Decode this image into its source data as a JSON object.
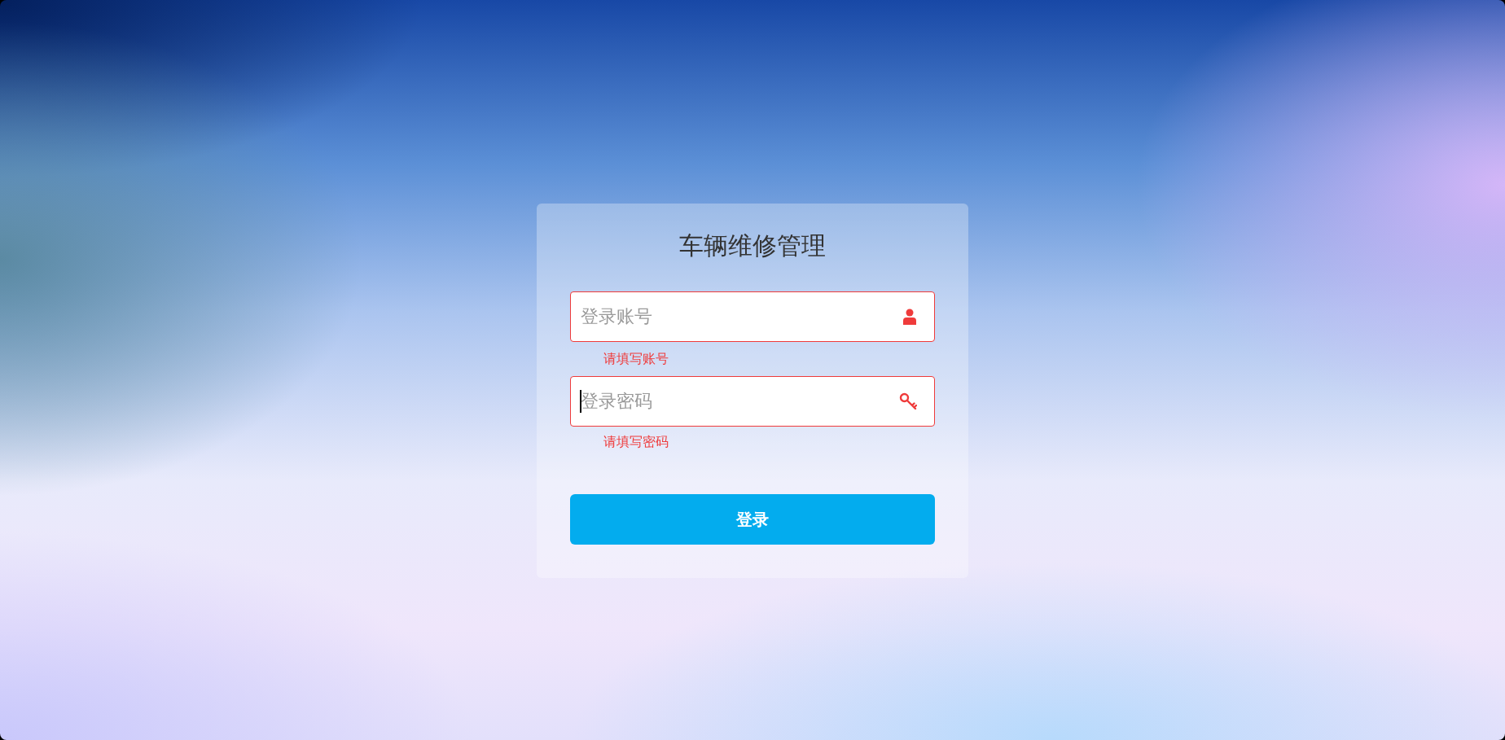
{
  "title": "车辆维修管理",
  "fields": [
    {
      "kind": "user",
      "placeholder": "登录账号",
      "invalid": true,
      "focused": false,
      "error": "请填写账号"
    },
    {
      "kind": "key",
      "placeholder": "登录密码",
      "invalid": true,
      "focused": true,
      "error": "请填写密码"
    }
  ],
  "submit_button": "登录"
}
